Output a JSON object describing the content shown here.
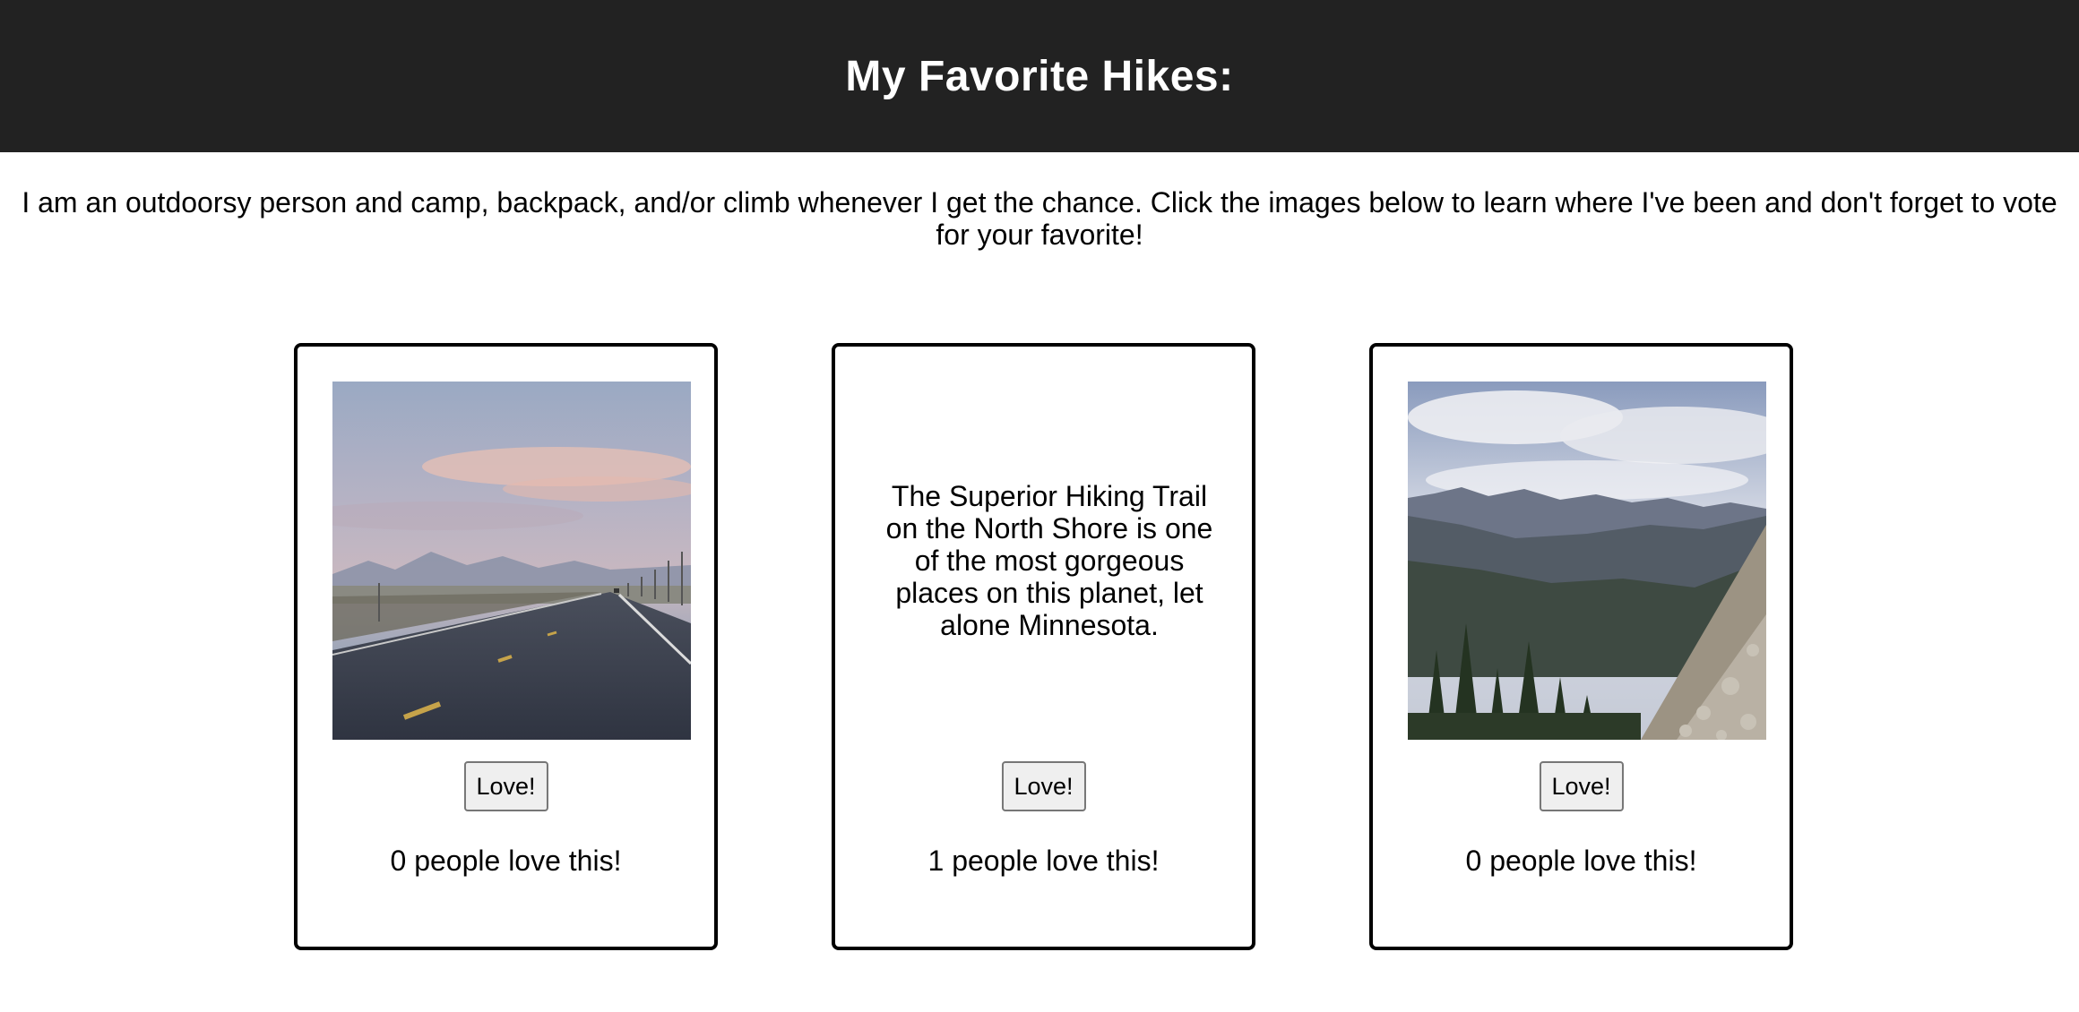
{
  "header": {
    "title": "My Favorite Hikes:"
  },
  "intro": {
    "text": "I am an outdoorsy person and camp, backpack, and/or climb whenever I get the chance. Click the images below to learn where I've been and don't forget to vote for your favorite!"
  },
  "cards": [
    {
      "image": "road-mountains-photo",
      "love_label": "Love!",
      "count_text": "0 people love this!"
    },
    {
      "description": "The Superior Hiking Trail on the North Shore is one of the most gorgeous places on this planet, let alone Minnesota.",
      "love_label": "Love!",
      "count_text": "1 people love this!"
    },
    {
      "image": "mountain-valley-photo",
      "love_label": "Love!",
      "count_text": "0 people love this!"
    }
  ],
  "colors": {
    "header_bg": "#222222",
    "header_text": "#ffffff",
    "card_border": "#000000",
    "button_bg": "#efefef"
  }
}
